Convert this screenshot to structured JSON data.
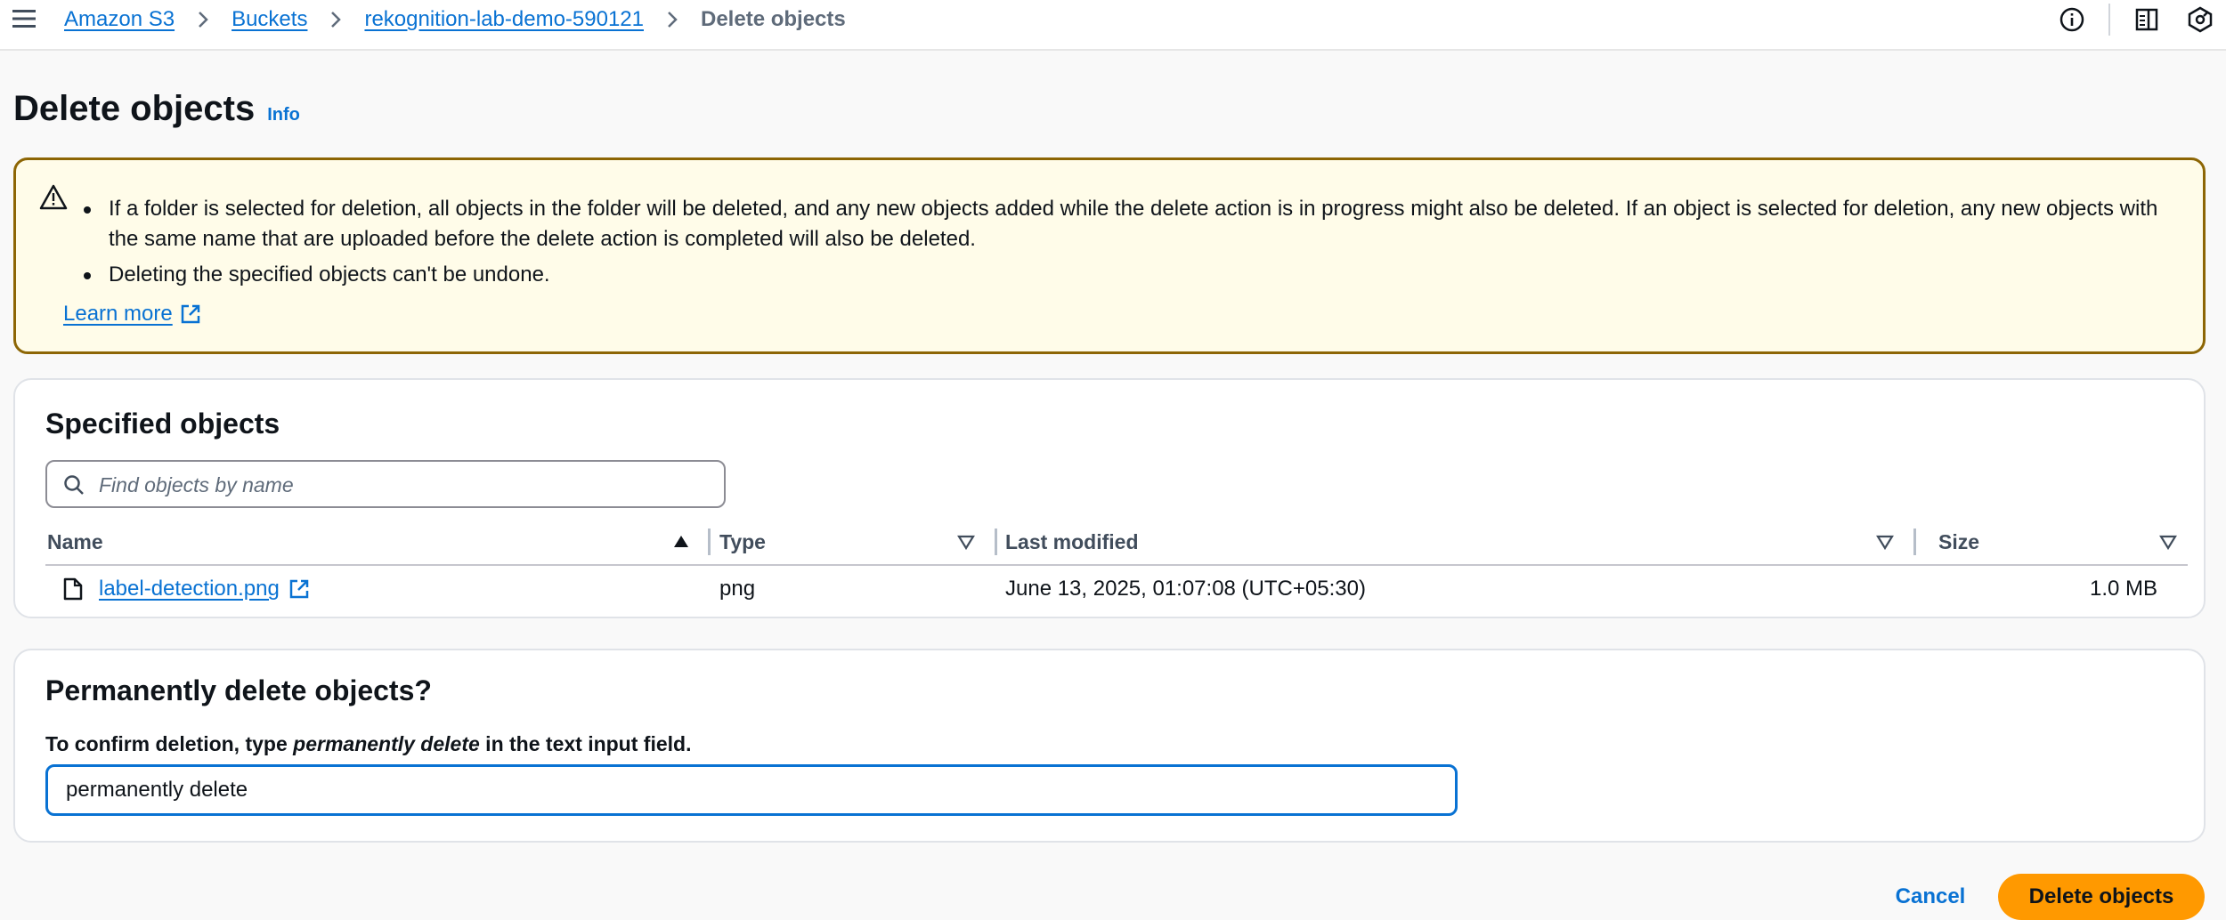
{
  "breadcrumb": {
    "items": [
      "Amazon S3",
      "Buckets",
      "rekognition-lab-demo-590121"
    ],
    "current": "Delete objects"
  },
  "header": {
    "title": "Delete objects",
    "info_label": "Info"
  },
  "alert": {
    "bullets": [
      "If a folder is selected for deletion, all objects in the folder will be deleted, and any new objects added while the delete action is in progress might also be deleted. If an object is selected for deletion, any new objects with the same name that are uploaded before the delete action is completed will also be deleted.",
      "Deleting the specified objects can't be undone."
    ],
    "learn_more": "Learn more"
  },
  "specified": {
    "title": "Specified objects",
    "search_placeholder": "Find objects by name",
    "columns": [
      "Name",
      "Type",
      "Last modified",
      "Size"
    ],
    "rows": [
      {
        "name": "label-detection.png",
        "type": "png",
        "last_modified": "June 13, 2025, 01:07:08 (UTC+05:30)",
        "size": "1.0 MB"
      }
    ]
  },
  "confirm": {
    "title": "Permanently delete objects?",
    "label_prefix": "To confirm deletion, type ",
    "label_keyword": "permanently delete",
    "label_suffix": " in the text input field.",
    "input_value": "permanently delete"
  },
  "actions": {
    "cancel": "Cancel",
    "delete": "Delete objects"
  },
  "colors": {
    "link": "#0972d3",
    "primary_button": "#ff9900",
    "warning_border": "#8d6605",
    "warning_bg": "#fffce9"
  }
}
